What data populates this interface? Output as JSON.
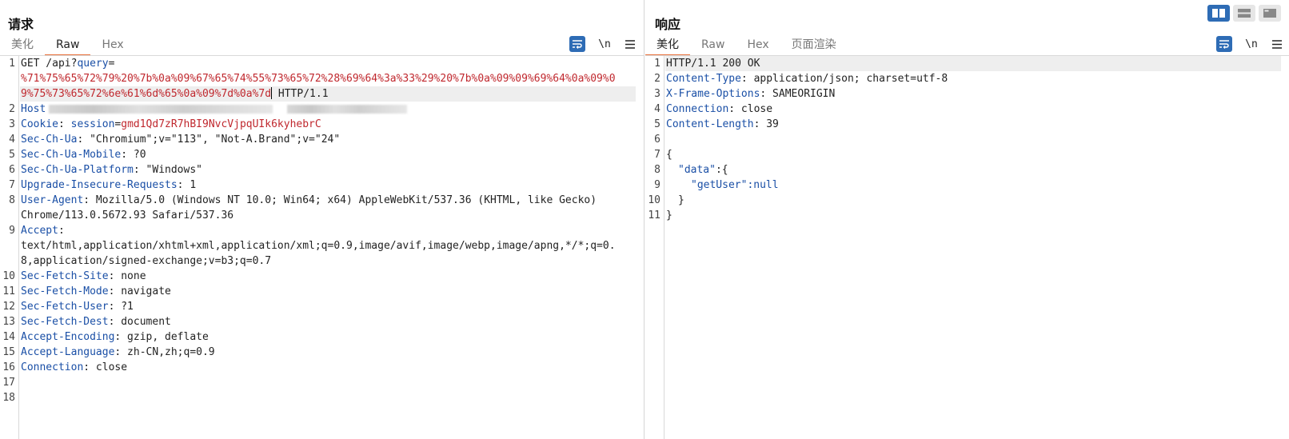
{
  "request": {
    "title": "请求",
    "tabs": [
      "美化",
      "Raw",
      "Hex"
    ],
    "active_tab": "Raw",
    "tools": {
      "newline_label": "\\n"
    },
    "line_numbers": [
      "1",
      "2",
      "3",
      "4",
      "5",
      "6",
      "7",
      "8",
      "9",
      "10",
      "11",
      "12",
      "13",
      "14",
      "15",
      "16",
      "17",
      "18"
    ],
    "lines": {
      "l1a": "GET /api?",
      "l1b": "query",
      "l1c": "=",
      "l1d": "%71%75%65%72%79%20%7b%0a%09%67%65%74%55%73%65%72%28%69%64%3a%33%29%20%7b%0a%09%09%69%64%0a%09%0",
      "l1e": "9%75%73%65%72%6e%61%6d%65%0a%09%7d%0a%7d",
      "l1f": " HTTP/1.1",
      "l2key": "Host",
      "l3key": "Cookie",
      "l3sep": ": ",
      "l3ckey": "session",
      "l3eq": "=",
      "l3val": "gmd1Qd7zR7hBI9NvcVjpqUIk6kyhebrC",
      "l4key": "Sec-Ch-Ua",
      "l4val": ": \"Chromium\";v=\"113\", \"Not-A.Brand\";v=\"24\"",
      "l5key": "Sec-Ch-Ua-Mobile",
      "l5val": ": ?0",
      "l6key": "Sec-Ch-Ua-Platform",
      "l6val": ": \"Windows\"",
      "l7key": "Upgrade-Insecure-Requests",
      "l7val": ": 1",
      "l8key": "User-Agent",
      "l8val": ": Mozilla/5.0 (Windows NT 10.0; Win64; x64) AppleWebKit/537.36 (KHTML, like Gecko)",
      "l8b": "Chrome/113.0.5672.93 Safari/537.36",
      "l9key": "Accept",
      "l9val": ":",
      "l9b": "text/html,application/xhtml+xml,application/xml;q=0.9,image/avif,image/webp,image/apng,*/*;q=0.",
      "l9c": "8,application/signed-exchange;v=b3;q=0.7",
      "l10key": "Sec-Fetch-Site",
      "l10val": ": none",
      "l11key": "Sec-Fetch-Mode",
      "l11val": ": navigate",
      "l12key": "Sec-Fetch-User",
      "l12val": ": ?1",
      "l13key": "Sec-Fetch-Dest",
      "l13val": ": document",
      "l14key": "Accept-Encoding",
      "l14val": ": gzip, deflate",
      "l15key": "Accept-Language",
      "l15val": ": zh-CN,zh;q=0.9",
      "l16key": "Connection",
      "l16val": ": close"
    }
  },
  "response": {
    "title": "响应",
    "tabs": [
      "美化",
      "Raw",
      "Hex",
      "页面渲染"
    ],
    "active_tab": "美化",
    "tools": {
      "newline_label": "\\n"
    },
    "line_numbers": [
      "1",
      "2",
      "3",
      "4",
      "5",
      "6",
      "7",
      "8",
      "9",
      "10",
      "11"
    ],
    "lines": {
      "l1": "HTTP/1.1 200 OK",
      "l2key": "Content-Type",
      "l2val": ": application/json; charset=utf-8",
      "l3key": "X-Frame-Options",
      "l3val": ": SAMEORIGIN",
      "l4key": "Connection",
      "l4val": ": close",
      "l5key": "Content-Length",
      "l5val": ": 39",
      "l7": "{",
      "l8key": "\"data\"",
      "l8rest": ":{",
      "l9key": "\"getUser\"",
      "l9rest": ":null",
      "l10": "}",
      "l11": "}"
    }
  },
  "colors": {
    "accent": "#2e6cb5",
    "tab_underline": "#e8703a",
    "header_key": "#1a4fa6",
    "param_value": "#c0282e"
  }
}
